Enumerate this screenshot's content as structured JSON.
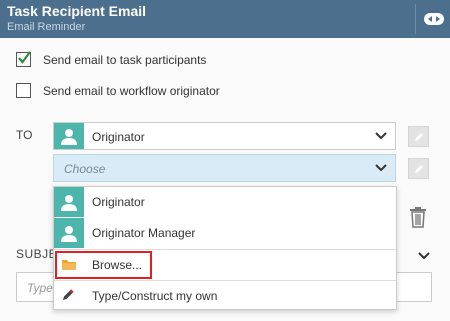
{
  "header": {
    "title": "Task Recipient Email",
    "subtitle": "Email Reminder",
    "toggle_icon": "collapse-arrows-icon"
  },
  "options": {
    "send_participants": {
      "label": "Send email to task participants",
      "checked": true
    },
    "send_originator": {
      "label": "Send email to workflow originator",
      "checked": false
    }
  },
  "to": {
    "label": "TO",
    "selected": "Originator",
    "choose_placeholder": "Choose"
  },
  "dropdown": {
    "items": [
      {
        "label": "Originator",
        "icon": "user-icon"
      },
      {
        "label": "Originator Manager",
        "icon": "user-icon"
      },
      {
        "label": "Browse...",
        "icon": "folder-icon"
      },
      {
        "label": "Type/Construct my own",
        "icon": "pencil-icon"
      }
    ]
  },
  "subject": {
    "label": "SUBJE",
    "placeholder": "Type"
  },
  "colors": {
    "header": "#4c6f8e",
    "avatar": "#4db6ac",
    "choose_bg": "#d9ebf7",
    "highlight": "#e02020"
  }
}
